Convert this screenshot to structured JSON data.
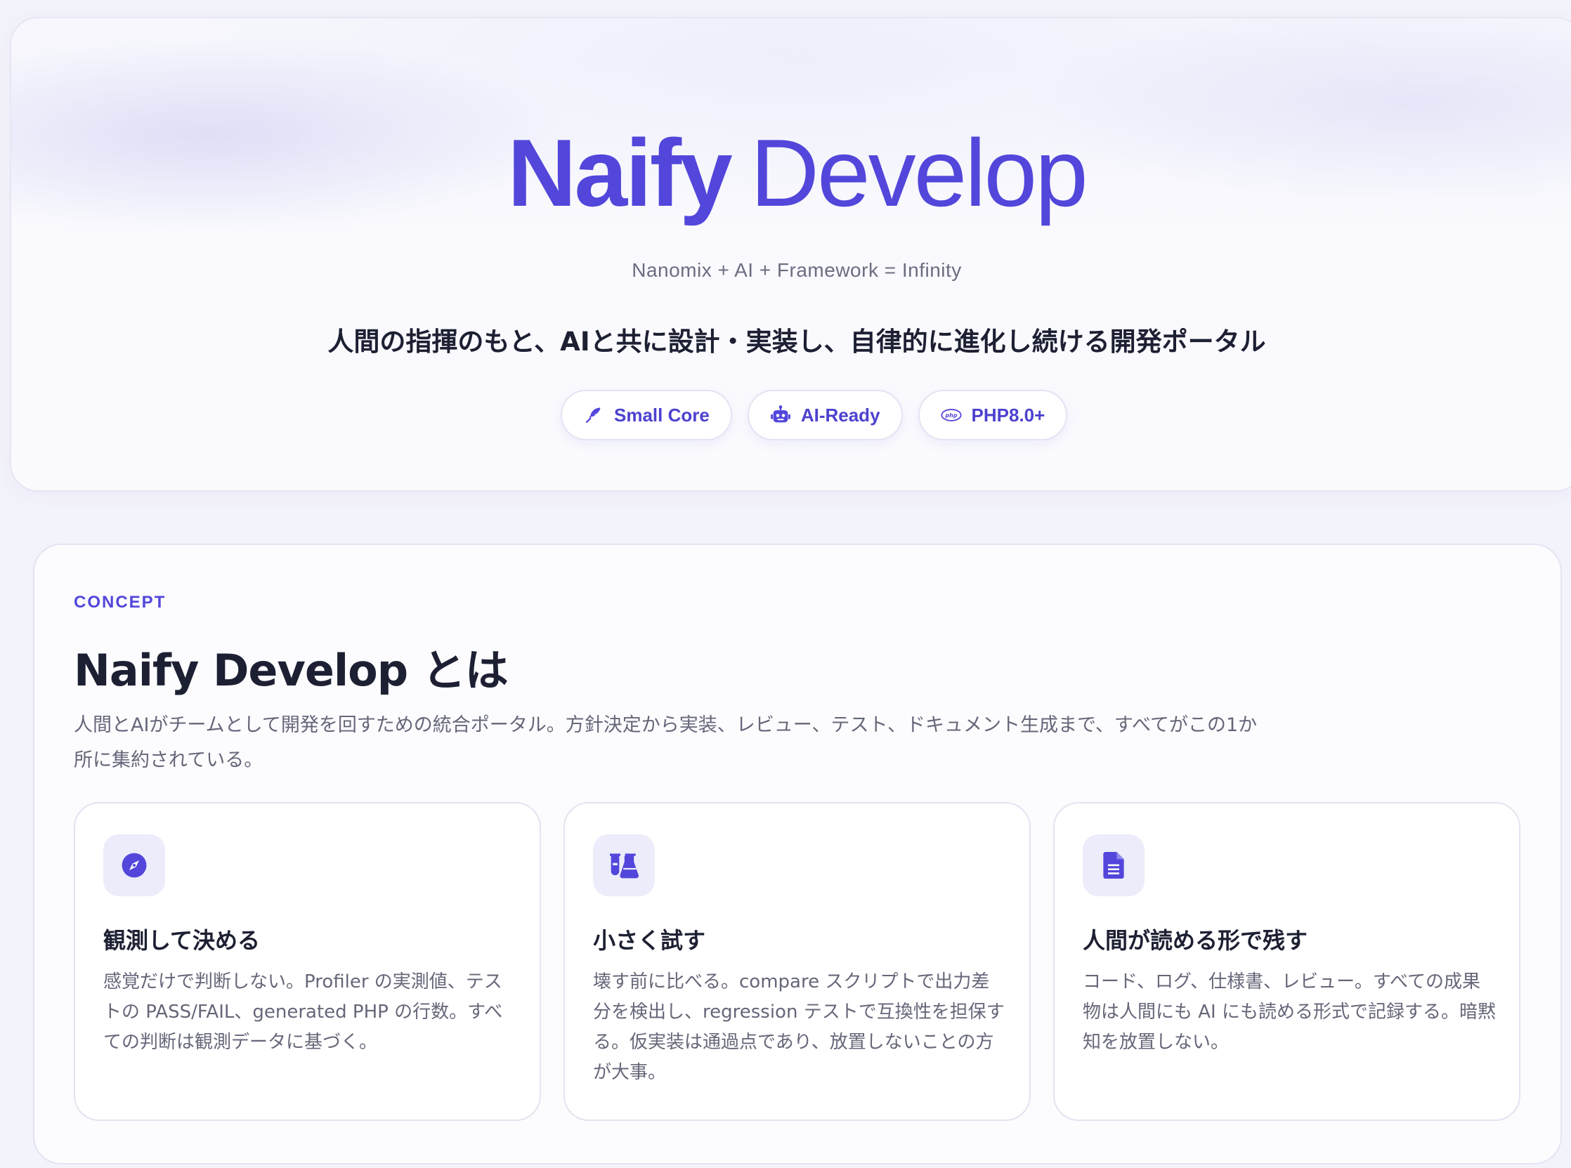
{
  "hero": {
    "title_strong": "Naify",
    "title_light": "Develop",
    "formula": "Nanomix + AI + Framework = Infinity",
    "tagline": "人間の指揮のもと、AIと共に設計・実装し、自律的に進化し続ける開発ポータル",
    "pills": [
      {
        "label": "Small Core",
        "icon": "feather-icon"
      },
      {
        "label": "AI-Ready",
        "icon": "robot-icon"
      },
      {
        "label": "PHP8.0+",
        "icon": "php-icon"
      }
    ]
  },
  "concept": {
    "eyebrow": "CONCEPT",
    "title": "Naify Develop とは",
    "description": "人間とAIがチームとして開発を回すための統合ポータル。方針決定から実装、レビュー、テスト、ドキュメント生成まで、すべてがこの1か所に集約されている。",
    "cards": [
      {
        "icon": "compass-icon",
        "title": "観測して決める",
        "text": "感覚だけで判断しない。Profiler の実測値、テストの PASS/FAIL、generated PHP の行数。すべての判断は観測データに基づく。"
      },
      {
        "icon": "flask-icon",
        "title": "小さく試す",
        "text": "壊す前に比べる。compare スクリプトで出力差分を検出し、regression テストで互換性を担保する。仮実装は通過点であり、放置しないことの方が大事。"
      },
      {
        "icon": "document-icon",
        "title": "人間が読める形で残す",
        "text": "コード、ログ、仕様書、レビュー。すべての成果物は人間にも AI にも読める形式で記録する。暗黙知を放置しない。"
      }
    ]
  },
  "colors": {
    "accent": "#5246db",
    "text": "#1d2033",
    "muted": "#656779",
    "background": "#f3f3fb",
    "icon_tile": "#ececfb"
  }
}
